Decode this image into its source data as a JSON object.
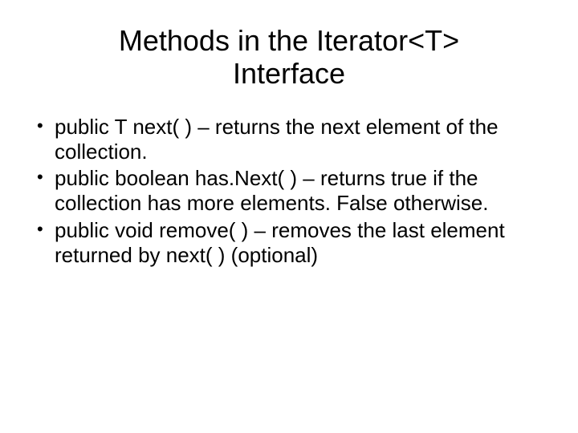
{
  "slide": {
    "title": "Methods in the Iterator<T> Interface",
    "bullets": [
      "public T next( ) – returns the next element of the collection.",
      "public boolean has.Next( ) – returns true if the collection has more elements. False otherwise.",
      "public void remove( ) – removes the last element returned by next( ) (optional)"
    ]
  }
}
